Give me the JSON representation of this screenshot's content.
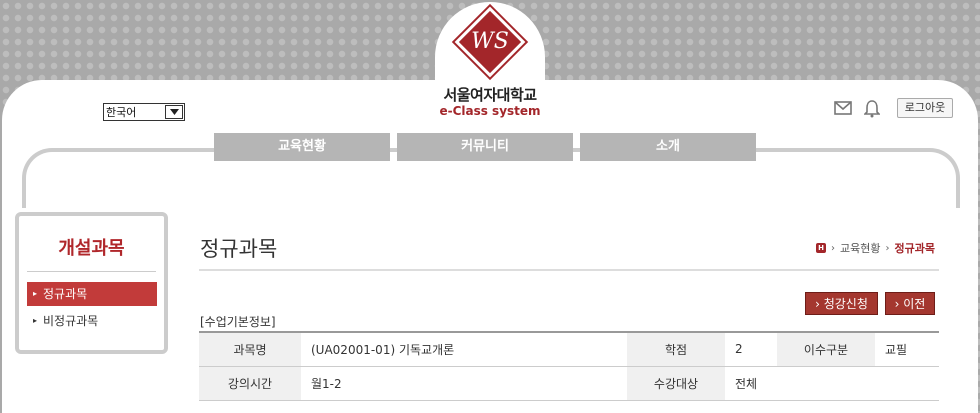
{
  "header": {
    "language": "한국어",
    "university_name": "서울여자대학교",
    "system_name": "e-Class system",
    "logout_label": "로그아웃"
  },
  "nav": {
    "items": [
      {
        "label": "교육현황"
      },
      {
        "label": "커뮤니티"
      },
      {
        "label": "소개"
      }
    ]
  },
  "sidebar": {
    "title": "개설과목",
    "items": [
      {
        "label": "정규과목",
        "active": true
      },
      {
        "label": "비정규과목",
        "active": false
      }
    ]
  },
  "main": {
    "page_title": "정규과목",
    "breadcrumb": {
      "home_badge": "H",
      "items": [
        "교육현황",
        "정규과목"
      ]
    },
    "buttons": {
      "enroll": "청강신청",
      "back": "이전"
    },
    "section_label": "[수업기본정보]",
    "table": {
      "row1": {
        "course_name_label": "과목명",
        "course_name_value": "(UA02001-01) 기독교개론",
        "credit_label": "학점",
        "credit_value": "2",
        "completion_type_label": "이수구분",
        "completion_type_value": "교필"
      },
      "row2": {
        "lecture_time_label": "강의시간",
        "lecture_time_value": "월1-2",
        "target_label": "수강대상",
        "target_value": "전체"
      }
    }
  },
  "colors": {
    "accent": "#a3262a",
    "active_menu": "#c23b3a",
    "nav_gray": "#b5b5b5"
  }
}
